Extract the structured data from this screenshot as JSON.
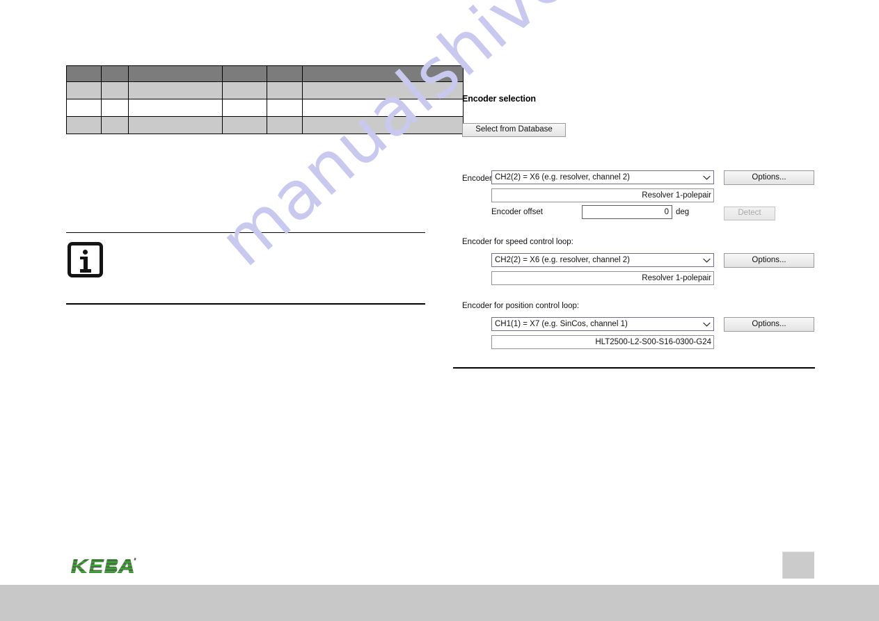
{
  "document": {
    "type": "manual-page",
    "watermark": "manualshive.com",
    "watermark_color": "#c9c9ef",
    "background": "#ffffff",
    "footer_bar_color": "#c8c8c8"
  },
  "spec_table": {
    "header_bg": "#7c7c7c",
    "shaded_row_bg": "#cacaca",
    "header": [
      "",
      "",
      "",
      "",
      "",
      ""
    ],
    "rows": [
      {
        "style": "shade",
        "cells": [
          "",
          "",
          "",
          "",
          "",
          ""
        ]
      },
      {
        "style": "plain",
        "cells": [
          "",
          "",
          "",
          "",
          "",
          ""
        ]
      },
      {
        "style": "shade",
        "cells": [
          "",
          "",
          "",
          "",
          "",
          ""
        ]
      }
    ]
  },
  "note": {
    "icon": "information-icon",
    "text": ""
  },
  "dialog": {
    "title": "Encoder selection",
    "select_from_database_label": "Select from Database",
    "options_label": "Options...",
    "detect_label": "Detect",
    "detect_enabled": false,
    "dropdown_arrow_icon": "chevron-down-icon",
    "sections": [
      {
        "label": "Encoder for commutation and torque control loop:",
        "selected": "CH2(2) = X6 (e.g. resolver, channel 2)",
        "readout": "Resolver 1-polepair",
        "offset_label": "Encoder offset",
        "offset_value": "0",
        "offset_unit": "deg"
      },
      {
        "label": "Encoder for speed control loop:",
        "selected": "CH2(2) = X6 (e.g. resolver, channel 2)",
        "readout": "Resolver 1-polepair"
      },
      {
        "label": "Encoder for position control loop:",
        "selected": "CH1(1) = X7 (e.g. SinCos, channel 1)",
        "readout": "HLT2500-L2-S00-S16-0300-G24"
      }
    ]
  },
  "footer": {
    "logo_text": "KEBA",
    "logo_green": "#2bb320",
    "logo_gray": "#5c5c5c",
    "page_number": ""
  }
}
